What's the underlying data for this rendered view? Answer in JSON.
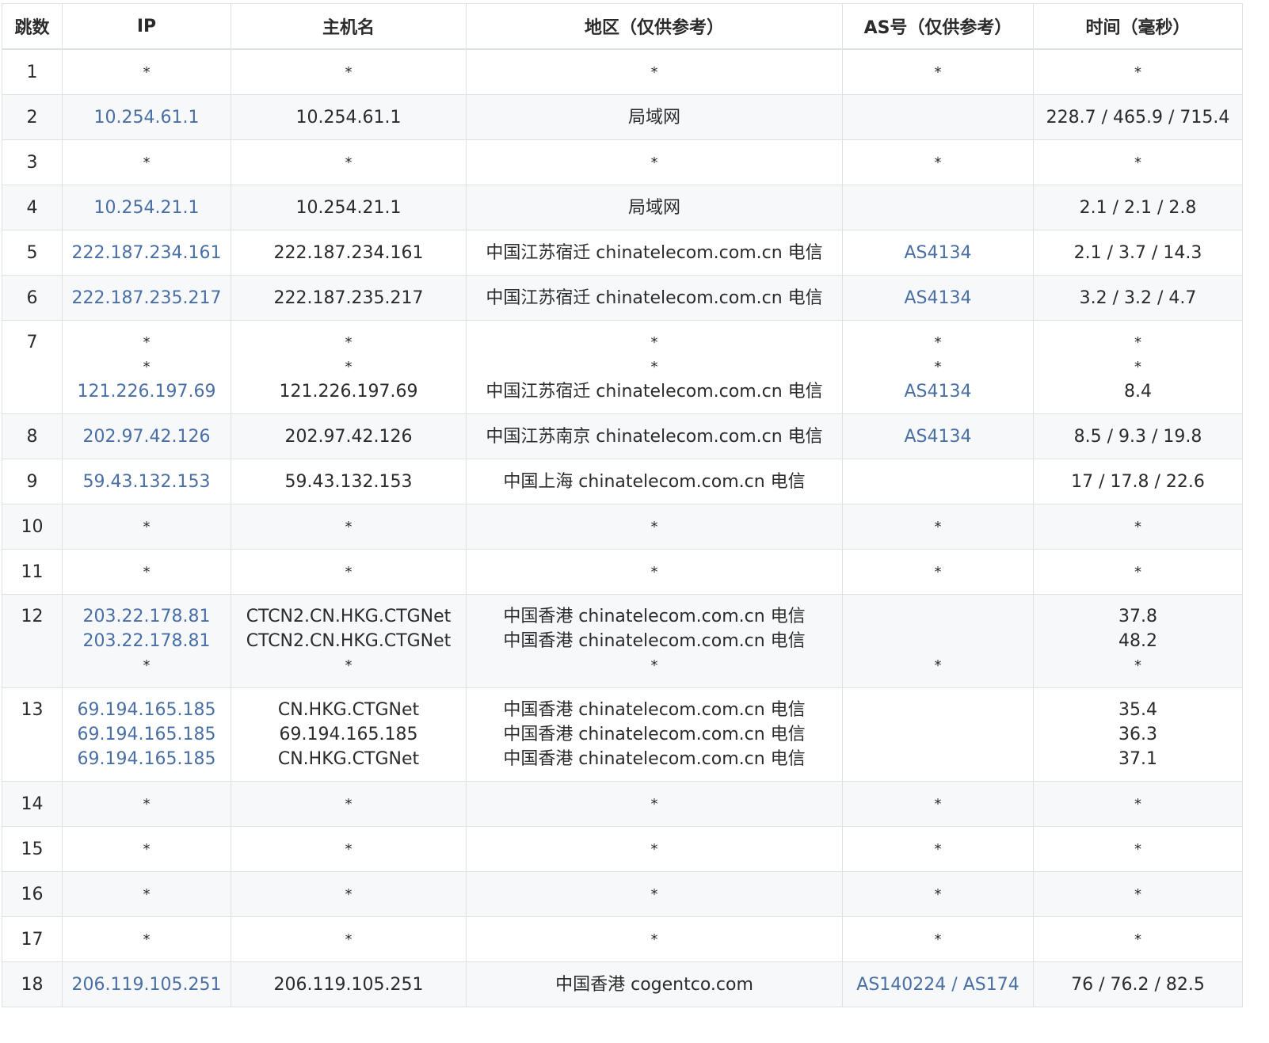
{
  "headers": [
    "跳数",
    "IP",
    "主机名",
    "地区（仅供参考）",
    "AS号（仅供参考）",
    "时间（毫秒）"
  ],
  "rows": [
    {
      "hop": "1",
      "ip": [
        "*"
      ],
      "host": [
        "*"
      ],
      "region": [
        "*"
      ],
      "as": [
        "*"
      ],
      "time": [
        "*"
      ]
    },
    {
      "hop": "2",
      "ip": [
        "10.254.61.1"
      ],
      "host": [
        "10.254.61.1"
      ],
      "region": [
        "局域网"
      ],
      "as": [
        ""
      ],
      "time": [
        "228.7 / 465.9 / 715.4"
      ]
    },
    {
      "hop": "3",
      "ip": [
        "*"
      ],
      "host": [
        "*"
      ],
      "region": [
        "*"
      ],
      "as": [
        "*"
      ],
      "time": [
        "*"
      ]
    },
    {
      "hop": "4",
      "ip": [
        "10.254.21.1"
      ],
      "host": [
        "10.254.21.1"
      ],
      "region": [
        "局域网"
      ],
      "as": [
        ""
      ],
      "time": [
        "2.1 / 2.1 / 2.8"
      ]
    },
    {
      "hop": "5",
      "ip": [
        "222.187.234.161"
      ],
      "host": [
        "222.187.234.161"
      ],
      "region": [
        "中国江苏宿迁 chinatelecom.com.cn 电信"
      ],
      "as": [
        "AS4134"
      ],
      "time": [
        "2.1 / 3.7 / 14.3"
      ]
    },
    {
      "hop": "6",
      "ip": [
        "222.187.235.217"
      ],
      "host": [
        "222.187.235.217"
      ],
      "region": [
        "中国江苏宿迁 chinatelecom.com.cn 电信"
      ],
      "as": [
        "AS4134"
      ],
      "time": [
        "3.2 / 3.2 / 4.7"
      ]
    },
    {
      "hop": "7",
      "ip": [
        "*",
        "*",
        "121.226.197.69"
      ],
      "host": [
        "*",
        "*",
        "121.226.197.69"
      ],
      "region": [
        "*",
        "*",
        "中国江苏宿迁 chinatelecom.com.cn 电信"
      ],
      "as": [
        "*",
        "*",
        "AS4134"
      ],
      "time": [
        "*",
        "*",
        "8.4"
      ]
    },
    {
      "hop": "8",
      "ip": [
        "202.97.42.126"
      ],
      "host": [
        "202.97.42.126"
      ],
      "region": [
        "中国江苏南京 chinatelecom.com.cn 电信"
      ],
      "as": [
        "AS4134"
      ],
      "time": [
        "8.5 / 9.3 / 19.8"
      ]
    },
    {
      "hop": "9",
      "ip": [
        "59.43.132.153"
      ],
      "host": [
        "59.43.132.153"
      ],
      "region": [
        "中国上海 chinatelecom.com.cn 电信"
      ],
      "as": [
        ""
      ],
      "time": [
        "17 / 17.8 / 22.6"
      ]
    },
    {
      "hop": "10",
      "ip": [
        "*"
      ],
      "host": [
        "*"
      ],
      "region": [
        "*"
      ],
      "as": [
        "*"
      ],
      "time": [
        "*"
      ]
    },
    {
      "hop": "11",
      "ip": [
        "*"
      ],
      "host": [
        "*"
      ],
      "region": [
        "*"
      ],
      "as": [
        "*"
      ],
      "time": [
        "*"
      ]
    },
    {
      "hop": "12",
      "ip": [
        "203.22.178.81",
        "203.22.178.81",
        "*"
      ],
      "host": [
        "CTCN2.CN.HKG.CTGNet",
        "CTCN2.CN.HKG.CTGNet",
        "*"
      ],
      "region": [
        "中国香港 chinatelecom.com.cn 电信",
        "中国香港 chinatelecom.com.cn 电信",
        "*"
      ],
      "as": [
        "",
        "",
        "*"
      ],
      "time": [
        "37.8",
        "48.2",
        "*"
      ]
    },
    {
      "hop": "13",
      "ip": [
        "69.194.165.185",
        "69.194.165.185",
        "69.194.165.185"
      ],
      "host": [
        "CN.HKG.CTGNet",
        "69.194.165.185",
        "CN.HKG.CTGNet"
      ],
      "region": [
        "中国香港 chinatelecom.com.cn 电信",
        "中国香港 chinatelecom.com.cn 电信",
        "中国香港 chinatelecom.com.cn 电信"
      ],
      "as": [
        "",
        "",
        ""
      ],
      "time": [
        "35.4",
        "36.3",
        "37.1"
      ]
    },
    {
      "hop": "14",
      "ip": [
        "*"
      ],
      "host": [
        "*"
      ],
      "region": [
        "*"
      ],
      "as": [
        "*"
      ],
      "time": [
        "*"
      ]
    },
    {
      "hop": "15",
      "ip": [
        "*"
      ],
      "host": [
        "*"
      ],
      "region": [
        "*"
      ],
      "as": [
        "*"
      ],
      "time": [
        "*"
      ]
    },
    {
      "hop": "16",
      "ip": [
        "*"
      ],
      "host": [
        "*"
      ],
      "region": [
        "*"
      ],
      "as": [
        "*"
      ],
      "time": [
        "*"
      ]
    },
    {
      "hop": "17",
      "ip": [
        "*"
      ],
      "host": [
        "*"
      ],
      "region": [
        "*"
      ],
      "as": [
        "*"
      ],
      "time": [
        "*"
      ]
    },
    {
      "hop": "18",
      "ip": [
        "206.119.105.251"
      ],
      "host": [
        "206.119.105.251"
      ],
      "region": [
        "中国香港 cogentco.com"
      ],
      "as": [
        "AS140224 / AS174"
      ],
      "time": [
        "76 / 76.2 / 82.5"
      ]
    }
  ],
  "colors": {
    "link": "#4a6fa5",
    "stripe": "#f6f8fa",
    "border": "#dfe2e5",
    "text": "#2b2b2b"
  }
}
